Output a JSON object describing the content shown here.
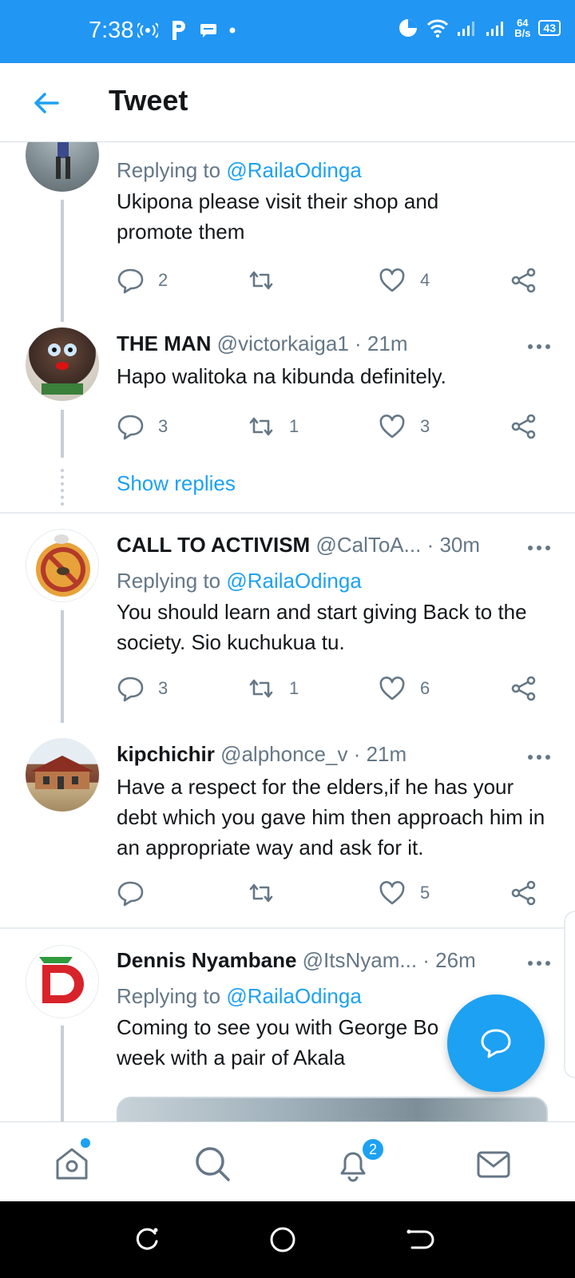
{
  "status_bar": {
    "time": "7:38",
    "net_speed_value": "64",
    "net_speed_unit": "B/s",
    "battery": "43"
  },
  "header": {
    "title": "Tweet"
  },
  "tweets": [
    {
      "reply_label": "Replying to",
      "reply_mention": "@RailaOdinga",
      "text": "Ukipona please visit their shop and promote them",
      "replies": "2",
      "retweets": "",
      "likes": "4"
    },
    {
      "name": "THE MAN",
      "handle": "@victorkaiga1",
      "time": "· 21m",
      "text": "Hapo walitoka na kibunda definitely.",
      "replies": "3",
      "retweets": "1",
      "likes": "3"
    },
    {
      "name": "CALL TO ACTIVISM",
      "handle": "@CalToA...",
      "time": "· 30m",
      "reply_label": "Replying to",
      "reply_mention": "@RailaOdinga",
      "text": "You should learn and start giving Back to the society. Sio kuchukua tu.",
      "replies": "3",
      "retweets": "1",
      "likes": "6"
    },
    {
      "name": "kipchichir",
      "handle": "@alphonce_v",
      "time": "· 21m",
      "text": "Have a respect for the elders,if he has your debt which you gave him then approach him in an appropriate way and ask for it.",
      "replies": "",
      "retweets": "",
      "likes": "5"
    },
    {
      "name": "Dennis Nyambane",
      "handle": "@ItsNyam...",
      "time": "· 26m",
      "reply_label": "Replying to",
      "reply_mention": "@RailaOdinga",
      "text": "Coming to see you with George Bo week with a pair of Akala",
      "replies": "",
      "retweets": "",
      "likes": ""
    }
  ],
  "show_replies": "Show replies",
  "bottom_nav": {
    "notifications_badge": "2"
  },
  "colors": {
    "status_bar": "#2196f3",
    "accent": "#1da1f2",
    "muted": "#657786",
    "text": "#14171a"
  }
}
